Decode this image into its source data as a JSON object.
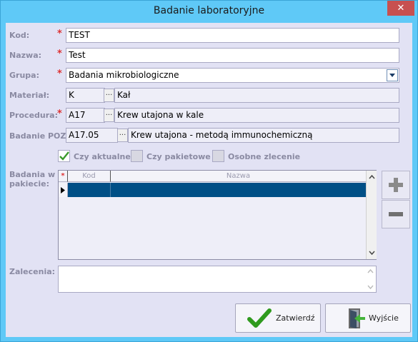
{
  "window": {
    "title": "Badanie laboratoryjne",
    "close_glyph": "✕"
  },
  "form": {
    "kod": {
      "label": "Kod:",
      "value": "TEST"
    },
    "nazwa": {
      "label": "Nazwa:",
      "value": "Test"
    },
    "grupa": {
      "label": "Grupa:",
      "value": "Badania mikrobiologiczne"
    },
    "material": {
      "label": "Materiał:",
      "code": "K",
      "lookup": "...",
      "desc": "Kał"
    },
    "procedura": {
      "label": "Procedura:",
      "code": "A17",
      "lookup": "...",
      "desc": "Krew utajona w kale"
    },
    "badanie_poz": {
      "label": "Badanie POZ:",
      "code": "A17.05",
      "lookup": "...",
      "desc": "Krew utajona - metodą immunochemiczną"
    },
    "required_marker": "*"
  },
  "checkboxes": [
    {
      "label": "Czy aktualne",
      "checked": true
    },
    {
      "label": "Czy pakietowe",
      "checked": false
    },
    {
      "label": "Osobne zlecenie",
      "checked": false
    }
  ],
  "package": {
    "label": "Badania w pakiecie:",
    "columns": {
      "marker": "*",
      "kod": "Kod",
      "nazwa": "Nazwa"
    },
    "rows": [
      {
        "kod": "",
        "nazwa": ""
      }
    ]
  },
  "zalecenia": {
    "label": "Zalecenia:",
    "value": ""
  },
  "buttons": {
    "confirm": "Zatwierdź",
    "exit": "Wyjście"
  },
  "colors": {
    "title_bar": "#5fc9f7",
    "client": "#e2e2f4",
    "selected_row": "#004f86",
    "required": "#dd3333"
  }
}
